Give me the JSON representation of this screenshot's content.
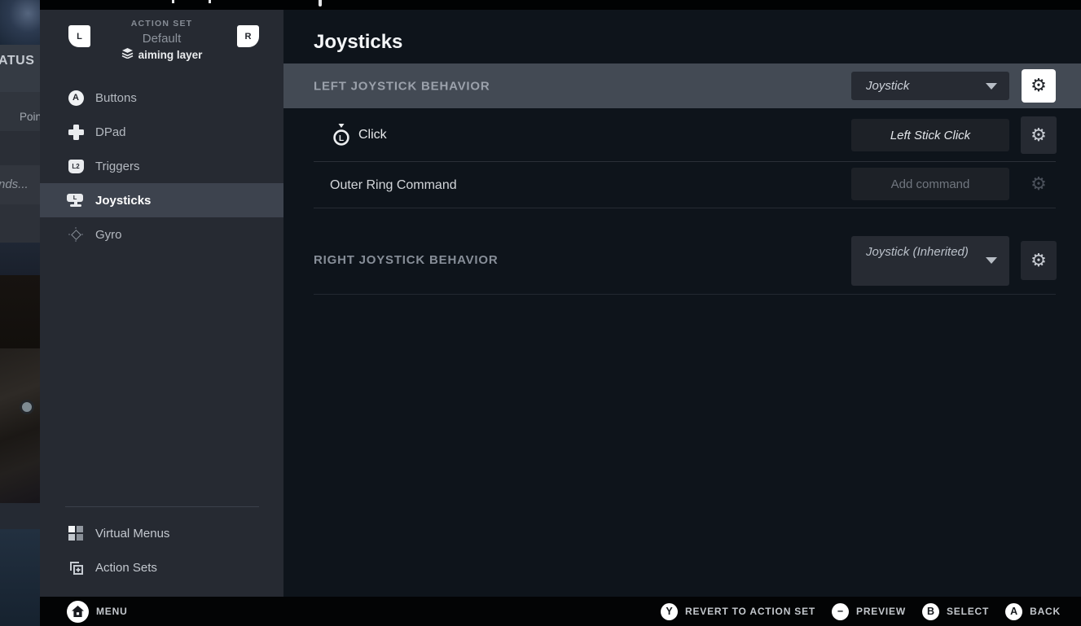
{
  "left_overlay": {
    "fragments": [
      "ATUS",
      "Poin",
      "nds..."
    ]
  },
  "sidebar": {
    "action_set_heading": "ACTION SET",
    "action_set_name": "Default",
    "active_layer": "aiming layer",
    "bumpers": {
      "left": "L",
      "right": "R"
    },
    "items": [
      {
        "label": "Buttons",
        "icon": "a-button-icon",
        "icon_label": "A",
        "selected": false
      },
      {
        "label": "DPad",
        "icon": "dpad-icon",
        "selected": false
      },
      {
        "label": "Triggers",
        "icon": "trigger-icon",
        "icon_label": "L2",
        "selected": false
      },
      {
        "label": "Joysticks",
        "icon": "joystick-icon",
        "icon_label": "L",
        "selected": true
      },
      {
        "label": "Gyro",
        "icon": "gyro-icon",
        "selected": false
      }
    ],
    "footer_items": [
      {
        "label": "Virtual Menus",
        "icon": "grid-icon"
      },
      {
        "label": "Action Sets",
        "icon": "stacked-squares-plus-icon"
      }
    ]
  },
  "main": {
    "title": "Joysticks",
    "left_behavior": {
      "label": "LEFT JOYSTICK BEHAVIOR",
      "selected_mode": "Joystick"
    },
    "click_row": {
      "label": "Click",
      "binding": "Left Stick Click",
      "icon_label": "L"
    },
    "outer_ring_row": {
      "label": "Outer Ring Command",
      "binding_placeholder": "Add command"
    },
    "right_behavior": {
      "label": "RIGHT JOYSTICK BEHAVIOR",
      "selected_mode": "Joystick (Inherited)"
    }
  },
  "bottom_bar": {
    "menu_label": "MENU",
    "actions": [
      {
        "button": "Y",
        "label": "REVERT TO ACTION SET"
      },
      {
        "button": "−",
        "label": "PREVIEW"
      },
      {
        "button": "B",
        "label": "SELECT"
      },
      {
        "button": "A",
        "label": "BACK"
      }
    ]
  },
  "colors": {
    "main_bg": "#0e141b",
    "sidebar_bg": "#262a32",
    "selected_row_bg": "#3d434e",
    "section_header_bg": "#434a54",
    "control_bg": "#272b33",
    "value_button_bg": "#1d2127",
    "focused_button_bg": "#ffffff",
    "bottom_bar_bg": "#030405"
  }
}
